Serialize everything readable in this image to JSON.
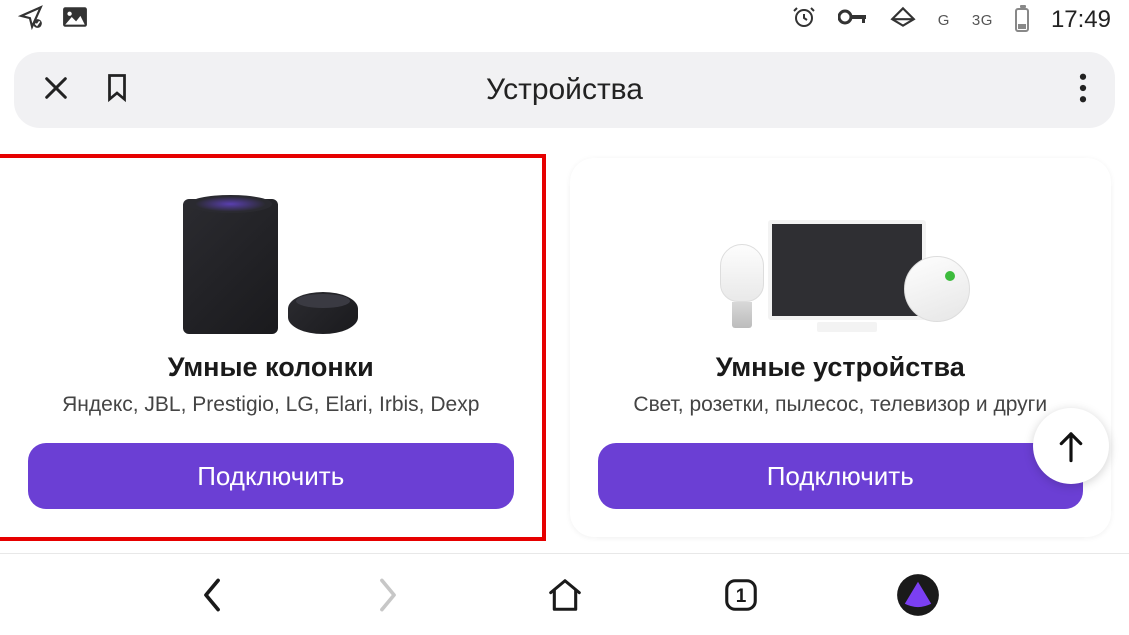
{
  "status": {
    "net_g": "G",
    "net_3g": "3G",
    "time": "17:49"
  },
  "appbar": {
    "title": "Устройства"
  },
  "cards": [
    {
      "title": "Умные колонки",
      "subtitle": "Яндекс, JBL, Prestigio, LG, Elari, Irbis, Dexp",
      "button": "Подключить"
    },
    {
      "title": "Умные устройства",
      "subtitle": "Свет, розетки, пылесос, телевизор и други",
      "button": "Подключить"
    }
  ],
  "bottomnav": {
    "tab_count": "1"
  }
}
